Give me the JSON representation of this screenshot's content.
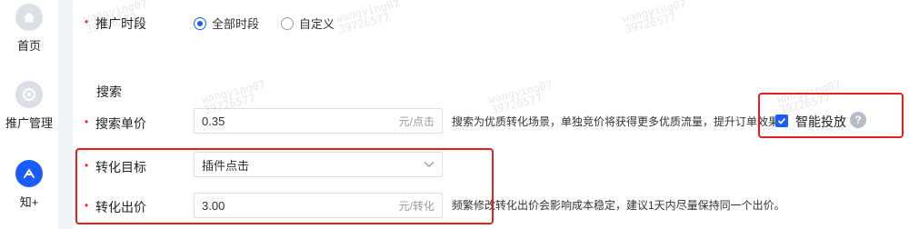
{
  "sidebar": {
    "items": [
      {
        "label": "首页",
        "icon": "home-icon"
      },
      {
        "label": "推广管理",
        "icon": "promotion-manage-icon"
      },
      {
        "label": "知+",
        "icon": "zhi-plus-icon",
        "active": true
      }
    ]
  },
  "form": {
    "time_period": {
      "label": "推广时段",
      "options": [
        {
          "label": "全部时段",
          "checked": true
        },
        {
          "label": "自定义",
          "checked": false
        }
      ]
    },
    "search_section": {
      "title": "搜索"
    },
    "search_bid": {
      "label": "搜索单价",
      "value": "0.35",
      "unit": "元/点击",
      "hint": "搜索为优质转化场景，单独竞价将获得更多优质流量，提升订单效果",
      "smart_label": "智能投放",
      "smart_checked": true
    },
    "conversion_target": {
      "label": "转化目标",
      "value": "插件点击"
    },
    "conversion_bid": {
      "label": "转化出价",
      "value": "3.00",
      "unit": "元/转化",
      "hint": "频繁修改转化出价会影响成本稳定，建议1天内尽量保持同一个出价。"
    }
  },
  "watermark": {
    "text": "wangying07",
    "id": "39726577"
  },
  "colors": {
    "accent": "#1a5cff",
    "required": "#f5222d",
    "highlight": "#e02020"
  }
}
